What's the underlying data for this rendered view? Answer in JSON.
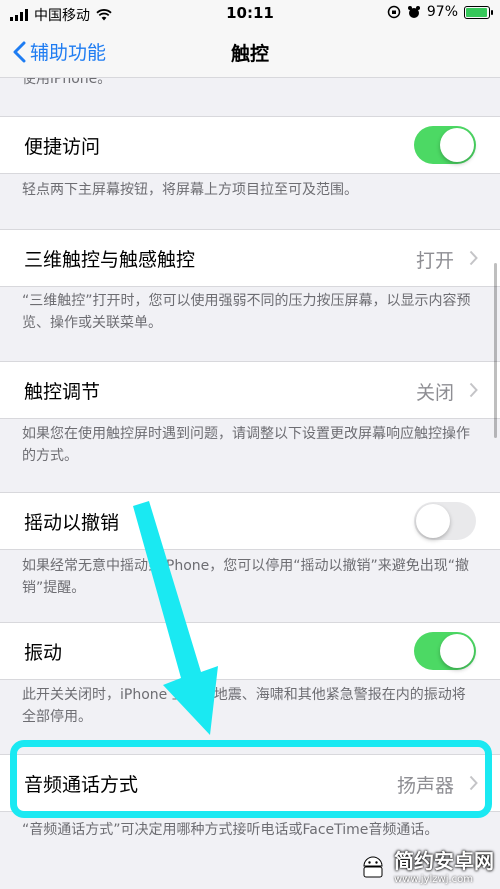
{
  "status_bar": {
    "carrier": "中国移动",
    "time": "10:11",
    "battery": "97%",
    "battery_level": 0.97
  },
  "nav": {
    "back_label": "辅助功能",
    "title": "触控"
  },
  "top_partial_text": "使用iPhone。",
  "rows": {
    "reachability": {
      "label": "便捷访问",
      "toggle": "on"
    },
    "touch_3d": {
      "label": "三维触控与触感触控",
      "value": "打开"
    },
    "accommodations": {
      "label": "触控调节",
      "value": "关闭"
    },
    "shake_undo": {
      "label": "摇动以撤销",
      "toggle": "off"
    },
    "vibration": {
      "label": "振动",
      "toggle": "on"
    },
    "call_audio": {
      "label": "音频通话方式",
      "value": "扬声器"
    }
  },
  "footers": {
    "reachability": "轻点两下主屏幕按钮，将屏幕上方项目拉至可及范围。",
    "touch_3d": "“三维触控”打开时，您可以使用强弱不同的压力按压屏幕，以显示内容预览、操作或关联菜单。",
    "accommodations": "如果您在使用触控屏时遇到问题，请调整以下设置更改屏幕响应触控操作的方式。",
    "shake_undo": "如果经常无意中摇动到iPhone，您可以停用“摇动以撤销”来避免出现“撤销”提醒。",
    "vibration": "此开关关闭时，iPhone 上包括地震、海啸和其他紧急警报在内的振动将全部停用。",
    "call_audio": "“音频通话方式”可决定用哪种方式接听电话或FaceTime音频通话。"
  },
  "watermark": {
    "brand": "简约安卓网",
    "url": "www.jylzwj.com"
  },
  "colors": {
    "accent": "#1e7cf2",
    "toggle_on": "#4cd964",
    "highlight": "#1ae9f2"
  }
}
